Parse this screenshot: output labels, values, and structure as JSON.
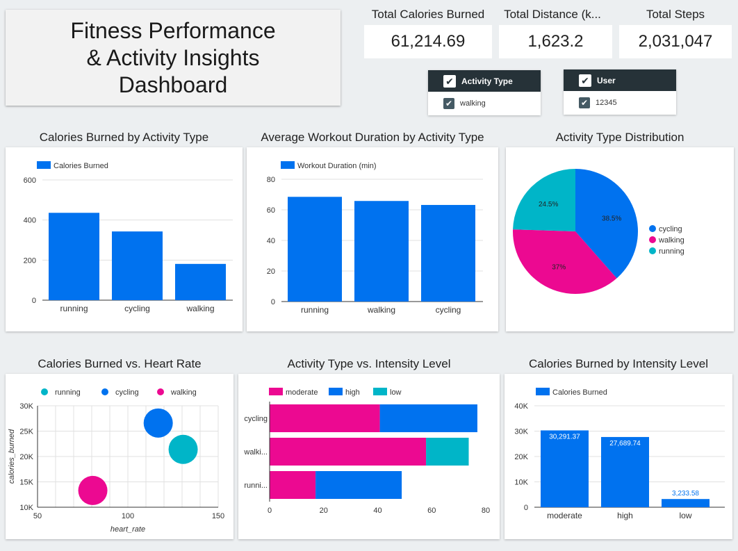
{
  "header": {
    "title": "Fitness Performance\n& Activity Insights\nDashboard"
  },
  "kpis": [
    {
      "label": "Total Calories Burned",
      "value": "61,214.69"
    },
    {
      "label": "Total Distance (k...",
      "value": "1,623.2"
    },
    {
      "label": "Total Steps",
      "value": "2,031,047"
    }
  ],
  "filters": [
    {
      "header": "Activity Type",
      "value": "walking"
    },
    {
      "header": "User",
      "value": "12345"
    }
  ],
  "colors": {
    "blue": "#0072ef",
    "pink": "#ec0991",
    "teal": "#00b5c8",
    "filter_header": "#263238"
  },
  "chart_data": [
    {
      "type": "bar",
      "title": "Calories Burned by Activity Type",
      "legend": "Calories Burned",
      "categories": [
        "running",
        "cycling",
        "walking"
      ],
      "values": [
        436,
        343,
        181
      ],
      "ylim": [
        0,
        600
      ],
      "yticks": [
        "0",
        "200",
        "400",
        "600"
      ]
    },
    {
      "type": "bar",
      "title": "Average Workout Duration by Activity Type",
      "legend": "Workout Duration (min)",
      "categories": [
        "running",
        "walking",
        "cycling"
      ],
      "values": [
        68.5,
        65.8,
        63.2
      ],
      "ylim": [
        0,
        80
      ],
      "yticks": [
        "0",
        "20",
        "40",
        "60",
        "80"
      ]
    },
    {
      "type": "pie",
      "title": "Activity Type Distribution",
      "slices": [
        {
          "label": "cycling",
          "value": 38.5,
          "text": "38.5%",
          "color": "#0072ef"
        },
        {
          "label": "walking",
          "value": 37,
          "text": "37%",
          "color": "#ec0991"
        },
        {
          "label": "running",
          "value": 24.5,
          "text": "24.5%",
          "color": "#00b5c8"
        }
      ],
      "legend_position": "right"
    },
    {
      "type": "scatter",
      "title": "Calories Burned vs. Heart Rate",
      "xlabel": "heart_rate",
      "ylabel": "calories_burned",
      "xlim": [
        50,
        150
      ],
      "ylim": [
        10000,
        30000
      ],
      "xticks": [
        "50",
        "100",
        "150"
      ],
      "yticks": [
        "10K",
        "15K",
        "20K",
        "25K",
        "30K"
      ],
      "series": [
        {
          "name": "running",
          "color": "#00b5c8",
          "points": [
            {
              "x": 130.6,
              "y": 21400
            }
          ]
        },
        {
          "name": "cycling",
          "color": "#0072ef",
          "points": [
            {
              "x": 116.8,
              "y": 26600
            }
          ]
        },
        {
          "name": "walking",
          "color": "#ec0991",
          "points": [
            {
              "x": 80.6,
              "y": 13300
            }
          ]
        }
      ],
      "legend_position": "top"
    },
    {
      "type": "bar",
      "orientation": "horizontal",
      "stacked": true,
      "title": "Activity Type vs. Intensity Level",
      "categories": [
        "cycling",
        "walki...",
        "runni..."
      ],
      "xlim": [
        0,
        80
      ],
      "xticks": [
        "0",
        "20",
        "40",
        "60",
        "80"
      ],
      "series": [
        {
          "name": "moderate",
          "color": "#ec0991",
          "values": [
            40.8,
            57.9,
            17
          ]
        },
        {
          "name": "high",
          "color": "#0072ef",
          "values": [
            36.1,
            0,
            31.9
          ]
        },
        {
          "name": "low",
          "color": "#00b5c8",
          "values": [
            0,
            15.8,
            0
          ]
        }
      ],
      "legend_position": "top"
    },
    {
      "type": "bar",
      "title": "Calories Burned by Intensity Level",
      "legend": "Calories Burned",
      "categories": [
        "moderate",
        "high",
        "low"
      ],
      "values": [
        30291.37,
        27689.74,
        3233.58
      ],
      "labels": [
        "30,291.37",
        "27,689.74",
        "3,233.58"
      ],
      "ylim": [
        0,
        40000
      ],
      "yticks": [
        "0",
        "10K",
        "20K",
        "30K",
        "40K"
      ]
    }
  ]
}
